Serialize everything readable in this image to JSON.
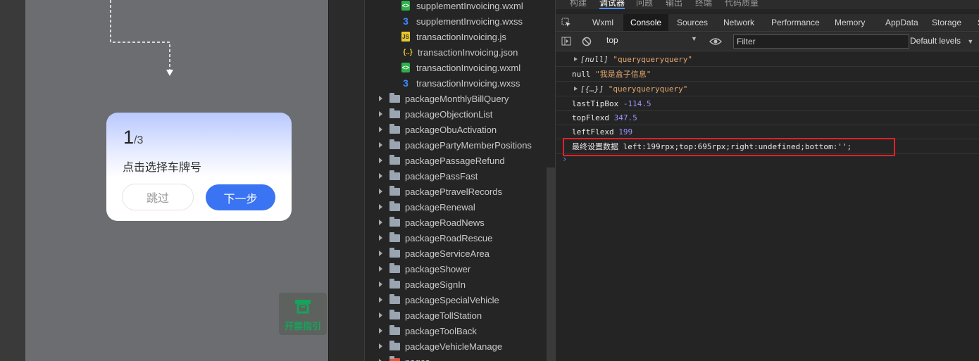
{
  "simulator": {
    "guide": {
      "current": "1",
      "total": "/3",
      "text": "点击选择车牌号",
      "skip_label": "跳过",
      "next_label": "下一步"
    },
    "floating_button": {
      "label": "开票指引",
      "icon": "invoice-icon"
    }
  },
  "file_tree": {
    "files": [
      {
        "name": "supplementInvoicing.wxml",
        "icon": "wxml-file-icon"
      },
      {
        "name": "supplementInvoicing.wxss",
        "icon": "wxss-file-icon"
      },
      {
        "name": "transactionInvoicing.js",
        "icon": "js-file-icon"
      },
      {
        "name": "transactionInvoicing.json",
        "icon": "json-file-icon"
      },
      {
        "name": "transactionInvoicing.wxml",
        "icon": "wxml-file-icon"
      },
      {
        "name": "transactionInvoicing.wxss",
        "icon": "wxss-file-icon"
      }
    ],
    "folders": [
      "packageMonthlyBillQuery",
      "packageObjectionList",
      "packageObuActivation",
      "packagePartyMemberPositions",
      "packagePassageRefund",
      "packagePassFast",
      "packagePtravelRecords",
      "packageRenewal",
      "packageRoadNews",
      "packageRoadRescue",
      "packageServiceArea",
      "packageShower",
      "packageSignIn",
      "packageSpecialVehicle",
      "packageTollStation",
      "packageToolBack",
      "packageVehicleManage",
      "pages"
    ]
  },
  "devtools": {
    "top_tabs": [
      "构建",
      "调试器",
      "问题",
      "输出",
      "终端",
      "代码质量"
    ],
    "top_tab_active": "调试器",
    "panel_tabs": [
      "Wxml",
      "Console",
      "Sources",
      "Network",
      "Performance",
      "Memory",
      "AppData",
      "Storage",
      "S"
    ],
    "panel_tab_active": "Console",
    "toolbar": {
      "context": "top",
      "filter_placeholder": "Filter",
      "levels": "Default levels"
    },
    "console": {
      "line1": {
        "obj": "[null]",
        "str": "\"queryqueryquery\""
      },
      "line2": {
        "label": "null",
        "str": "\"我是盒子信息\""
      },
      "line3": {
        "obj": "[{…}]",
        "str": "\"queryqueryquery\""
      },
      "line4": {
        "label": "lastTipBox",
        "num": "-114.5"
      },
      "line5": {
        "label": "topFlexd",
        "num": "347.5"
      },
      "line6": {
        "label": "leftFlexd",
        "num": "199"
      },
      "line7": {
        "text": "最终设置数据 left:199rpx;top:695rpx;right:undefined;bottom:'';"
      },
      "prompt": "›"
    }
  }
}
